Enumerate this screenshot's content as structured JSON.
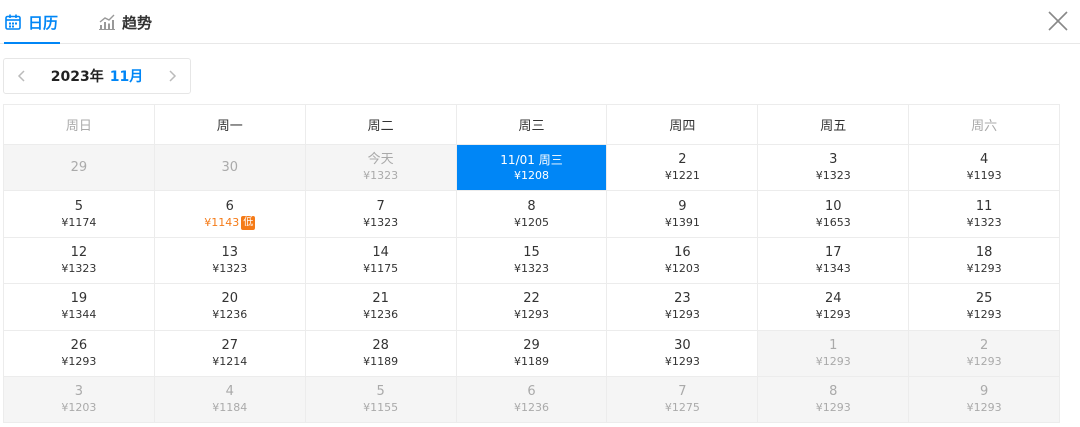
{
  "tabs": [
    {
      "label": "日历",
      "icon": "calendar-icon",
      "active": true
    },
    {
      "label": "趋势",
      "icon": "trend-chart-icon",
      "active": false
    }
  ],
  "accent_color": "#0086f6",
  "low_color": "#f57b18",
  "month_nav": {
    "year": "2023年",
    "month": "11月"
  },
  "weekdays": [
    "周日",
    "周一",
    "周二",
    "周三",
    "周四",
    "周五",
    "周六"
  ],
  "weeks": [
    [
      {
        "day": "29",
        "price": "",
        "state": "out"
      },
      {
        "day": "30",
        "price": "",
        "state": "out"
      },
      {
        "day": "今天",
        "price": "¥1323",
        "state": "out"
      },
      {
        "day": "11/01 周三",
        "price": "¥1208",
        "state": "selected"
      },
      {
        "day": "2",
        "price": "¥1221",
        "state": "normal"
      },
      {
        "day": "3",
        "price": "¥1323",
        "state": "normal"
      },
      {
        "day": "4",
        "price": "¥1193",
        "state": "normal"
      }
    ],
    [
      {
        "day": "5",
        "price": "¥1174",
        "state": "normal"
      },
      {
        "day": "6",
        "price": "¥1143",
        "state": "low",
        "badge": "低"
      },
      {
        "day": "7",
        "price": "¥1323",
        "state": "normal"
      },
      {
        "day": "8",
        "price": "¥1205",
        "state": "normal"
      },
      {
        "day": "9",
        "price": "¥1391",
        "state": "normal"
      },
      {
        "day": "10",
        "price": "¥1653",
        "state": "normal"
      },
      {
        "day": "11",
        "price": "¥1323",
        "state": "normal"
      }
    ],
    [
      {
        "day": "12",
        "price": "¥1323",
        "state": "normal"
      },
      {
        "day": "13",
        "price": "¥1323",
        "state": "normal"
      },
      {
        "day": "14",
        "price": "¥1175",
        "state": "normal"
      },
      {
        "day": "15",
        "price": "¥1323",
        "state": "normal"
      },
      {
        "day": "16",
        "price": "¥1203",
        "state": "normal"
      },
      {
        "day": "17",
        "price": "¥1343",
        "state": "normal"
      },
      {
        "day": "18",
        "price": "¥1293",
        "state": "normal"
      }
    ],
    [
      {
        "day": "19",
        "price": "¥1344",
        "state": "normal"
      },
      {
        "day": "20",
        "price": "¥1236",
        "state": "normal"
      },
      {
        "day": "21",
        "price": "¥1236",
        "state": "normal"
      },
      {
        "day": "22",
        "price": "¥1293",
        "state": "normal"
      },
      {
        "day": "23",
        "price": "¥1293",
        "state": "normal"
      },
      {
        "day": "24",
        "price": "¥1293",
        "state": "normal"
      },
      {
        "day": "25",
        "price": "¥1293",
        "state": "normal"
      }
    ],
    [
      {
        "day": "26",
        "price": "¥1293",
        "state": "normal"
      },
      {
        "day": "27",
        "price": "¥1214",
        "state": "normal"
      },
      {
        "day": "28",
        "price": "¥1189",
        "state": "normal"
      },
      {
        "day": "29",
        "price": "¥1189",
        "state": "normal"
      },
      {
        "day": "30",
        "price": "¥1293",
        "state": "normal"
      },
      {
        "day": "1",
        "price": "¥1293",
        "state": "out"
      },
      {
        "day": "2",
        "price": "¥1293",
        "state": "out"
      }
    ],
    [
      {
        "day": "3",
        "price": "¥1203",
        "state": "out"
      },
      {
        "day": "4",
        "price": "¥1184",
        "state": "out"
      },
      {
        "day": "5",
        "price": "¥1155",
        "state": "out"
      },
      {
        "day": "6",
        "price": "¥1236",
        "state": "out"
      },
      {
        "day": "7",
        "price": "¥1275",
        "state": "out"
      },
      {
        "day": "8",
        "price": "¥1293",
        "state": "out"
      },
      {
        "day": "9",
        "price": "¥1293",
        "state": "out"
      }
    ]
  ]
}
